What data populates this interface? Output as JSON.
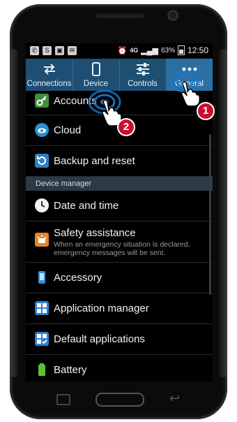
{
  "statusbar": {
    "network": "4G",
    "battery": "63%",
    "time": "12:50"
  },
  "tabs": [
    {
      "label": "Connections",
      "icon": "connections-arrows-icon"
    },
    {
      "label": "Device",
      "icon": "phone-icon"
    },
    {
      "label": "Controls",
      "icon": "sliders-icon"
    },
    {
      "label": "General",
      "icon": "more-dots-icon",
      "active": true
    }
  ],
  "list": {
    "accounts": "Accounts",
    "cloud": "Cloud",
    "backup": "Backup and reset",
    "section_device_manager": "Device manager",
    "date_time": "Date and time",
    "safety": "Safety assistance",
    "safety_sub": "When an emergency situation is declared, emergency messages will be sent.",
    "accessory": "Accessory",
    "app_manager": "Application manager",
    "default_apps": "Default applications",
    "battery": "Battery"
  },
  "annotations": {
    "step1": "1",
    "step2": "2"
  },
  "colors": {
    "tab_bg": "#1f4e73",
    "tab_active": "#2c6fa3",
    "badge": "#c8102e",
    "section_bg": "#2b3a48"
  }
}
